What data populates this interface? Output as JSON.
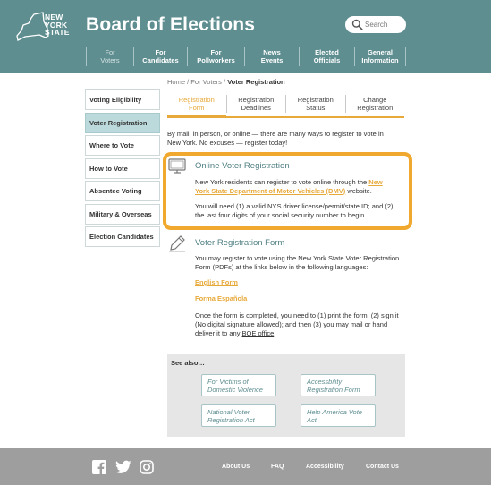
{
  "header": {
    "logo_lines": [
      "NEW",
      "YORK",
      "STATE"
    ],
    "site_title": "Board of Elections",
    "search": {
      "placeholder": "Search"
    },
    "nav": [
      {
        "line1": "For",
        "line2": "Voters",
        "active": true
      },
      {
        "line1": "For",
        "line2": "Candidates",
        "active": false
      },
      {
        "line1": "For",
        "line2": "Pollworkers",
        "active": false
      },
      {
        "line1": "News",
        "line2": "Events",
        "active": false
      },
      {
        "line1": "Elected",
        "line2": "Officials",
        "active": false
      },
      {
        "line1": "General",
        "line2": "Information",
        "active": false
      }
    ]
  },
  "sidebar": {
    "items": [
      {
        "label": "Voting Eligibility",
        "active": false
      },
      {
        "label": "Voter Registration",
        "active": true
      },
      {
        "label": "Where to Vote",
        "active": false
      },
      {
        "label": "How to Vote",
        "active": false
      },
      {
        "label": "Absentee Voting",
        "active": false
      },
      {
        "label": "Military & Overseas",
        "active": false
      },
      {
        "label": "Election Candidates",
        "active": false
      }
    ]
  },
  "breadcrumb": {
    "home": "Home",
    "sep": "/",
    "section": "For Voters",
    "current": "Voter Registration"
  },
  "tabs": [
    {
      "line1": "Registration",
      "line2": "Form",
      "active": true
    },
    {
      "line1": "Registration",
      "line2": "Deadlines",
      "active": false
    },
    {
      "line1": "Registration",
      "line2": "Status",
      "active": false
    },
    {
      "line1": "Change",
      "line2": "Registration",
      "active": false
    }
  ],
  "intro": {
    "line1": "By  mail, in person, or online — there are many ways to register to vote in",
    "line2": "New York. No excuses — register today!"
  },
  "online": {
    "title": "Online Voter Registration",
    "p1_before": "New York residents can register to vote online through the ",
    "p1_link_line1": "New",
    "p1_link_line2": "York State Department of Motor Vehicles (DMV)",
    "p1_after": " website.",
    "p2_line1": "You will need (1) a valid NYS driver license/permit/state ID; and (2)",
    "p2_line2": "the last four digits of your social security number to begin."
  },
  "form": {
    "title": "Voter Registration Form",
    "p1_line1": "You may register to vote using the New York State Voter Registration",
    "p1_line2": "Form (PDFs) at the links below in the following languages:",
    "link_english": "English Form",
    "link_spanish": "Forma Española",
    "p2_line1": "Once the form is completed, you need to (1) print the form; (2) sign it",
    "p2_line2": "(No digital signature allowed); and then (3) you may mail or hand",
    "p2_line3_before": "deliver it to any ",
    "p2_line3_link": "BOE office",
    "p2_line3_after": "."
  },
  "see_also": {
    "title": "See also…",
    "items": [
      {
        "line1": "For Victims of",
        "line2": "Domestic Violence"
      },
      {
        "line1": "Accessbility",
        "line2": "Registration Form"
      },
      {
        "line1": "National Voter",
        "line2": "Registration Act"
      },
      {
        "line1": "Help America Vote",
        "line2": "Act"
      }
    ]
  },
  "footer": {
    "social_icons": [
      "facebook-icon",
      "twitter-icon",
      "instagram-icon"
    ],
    "links": [
      "About Us",
      "FAQ",
      "Accessibility",
      "Contact Us"
    ]
  },
  "colors": {
    "header_bg": "#5f8e91",
    "accent_orange": "#e7a93a",
    "highlight_border": "#f0a92e",
    "sidebar_active": "#bcdadb",
    "footer_bg": "#9e9e9e",
    "see_also_bg": "#e6e6e6"
  }
}
